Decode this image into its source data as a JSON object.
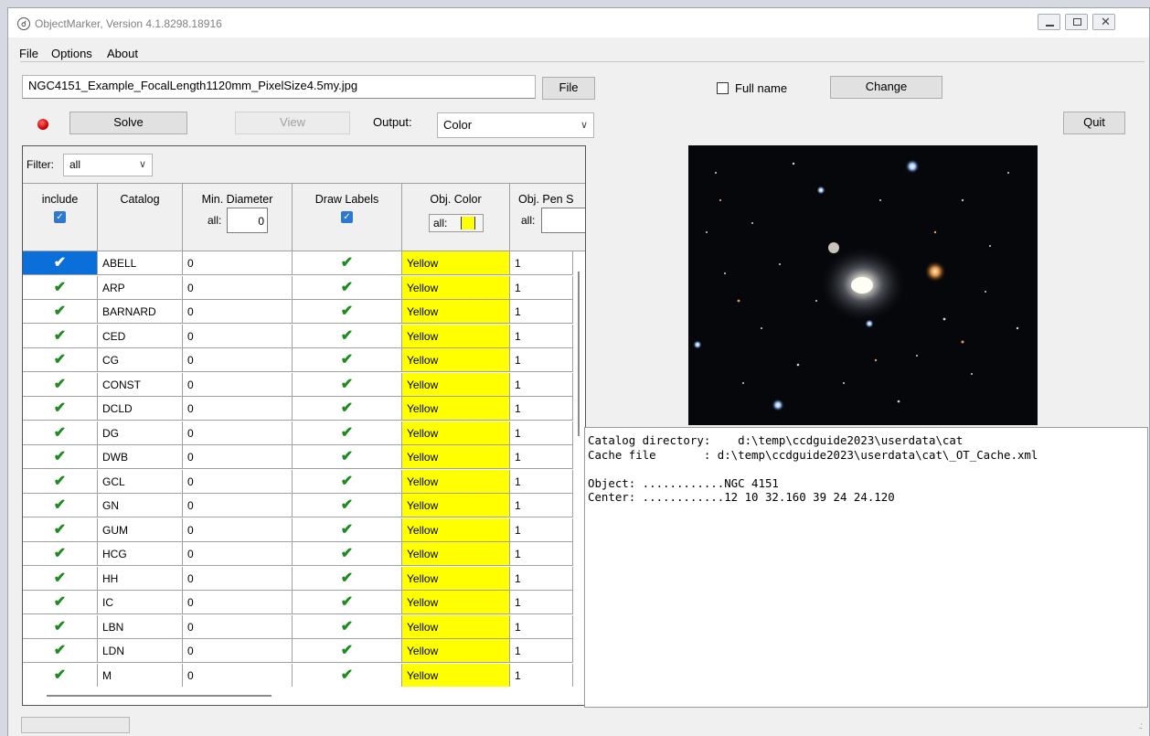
{
  "window": {
    "title": "ObjectMarker, Version 4.1.8298.18916"
  },
  "menu": {
    "items": [
      "File",
      "Options",
      "About"
    ]
  },
  "toolbar": {
    "filename_value": "NGC4151_Example_FocalLength1120mm_PixelSize4.5my.jpg",
    "file_button": "File",
    "full_name_label": "Full name",
    "full_name_checked": false,
    "change_button": "Change",
    "solve_button": "Solve",
    "view_button": "View",
    "output_label": "Output:",
    "output_value": "Color",
    "quit_button": "Quit",
    "status_indicator_color": "#d40000"
  },
  "grid": {
    "filter_label": "Filter:",
    "filter_value": "all",
    "headers": {
      "include": "include",
      "catalog": "Catalog",
      "min_diameter": "Min. Diameter",
      "draw_labels": "Draw Labels",
      "obj_color": "Obj. Color",
      "obj_pen": "Obj. Pen S"
    },
    "all_label": "all:",
    "min_diameter_all_value": "0",
    "obj_color_all_value": "#ffff00",
    "rows": [
      {
        "catalog": "ABELL",
        "min_diameter": "0",
        "color": "Yellow",
        "pen": "1"
      },
      {
        "catalog": "ARP",
        "min_diameter": "0",
        "color": "Yellow",
        "pen": "1"
      },
      {
        "catalog": "BARNARD",
        "min_diameter": "0",
        "color": "Yellow",
        "pen": "1"
      },
      {
        "catalog": "CED",
        "min_diameter": "0",
        "color": "Yellow",
        "pen": "1"
      },
      {
        "catalog": "CG",
        "min_diameter": "0",
        "color": "Yellow",
        "pen": "1"
      },
      {
        "catalog": "CONST",
        "min_diameter": "0",
        "color": "Yellow",
        "pen": "1"
      },
      {
        "catalog": "DCLD",
        "min_diameter": "0",
        "color": "Yellow",
        "pen": "1"
      },
      {
        "catalog": "DG",
        "min_diameter": "0",
        "color": "Yellow",
        "pen": "1"
      },
      {
        "catalog": "DWB",
        "min_diameter": "0",
        "color": "Yellow",
        "pen": "1"
      },
      {
        "catalog": "GCL",
        "min_diameter": "0",
        "color": "Yellow",
        "pen": "1"
      },
      {
        "catalog": "GN",
        "min_diameter": "0",
        "color": "Yellow",
        "pen": "1"
      },
      {
        "catalog": "GUM",
        "min_diameter": "0",
        "color": "Yellow",
        "pen": "1"
      },
      {
        "catalog": "HCG",
        "min_diameter": "0",
        "color": "Yellow",
        "pen": "1"
      },
      {
        "catalog": "HH",
        "min_diameter": "0",
        "color": "Yellow",
        "pen": "1"
      },
      {
        "catalog": "IC",
        "min_diameter": "0",
        "color": "Yellow",
        "pen": "1"
      },
      {
        "catalog": "LBN",
        "min_diameter": "0",
        "color": "Yellow",
        "pen": "1"
      },
      {
        "catalog": "LDN",
        "min_diameter": "0",
        "color": "Yellow",
        "pen": "1"
      },
      {
        "catalog": "M",
        "min_diameter": "0",
        "color": "Yellow",
        "pen": "1"
      }
    ],
    "selected_row": 0,
    "check_color": "#1f8a1f",
    "selection_color": "#0a6fd8",
    "cell_color": "#ffff00"
  },
  "console": {
    "lines": [
      "Catalog directory:    d:\\temp\\ccdguide2023\\userdata\\cat",
      "Cache file       : d:\\temp\\ccdguide2023\\userdata\\cat\\_OT_Cache.xml",
      "",
      "Object: ............NGC 4151",
      "Center: ............12 10 32.160 39 24 24.120"
    ]
  }
}
